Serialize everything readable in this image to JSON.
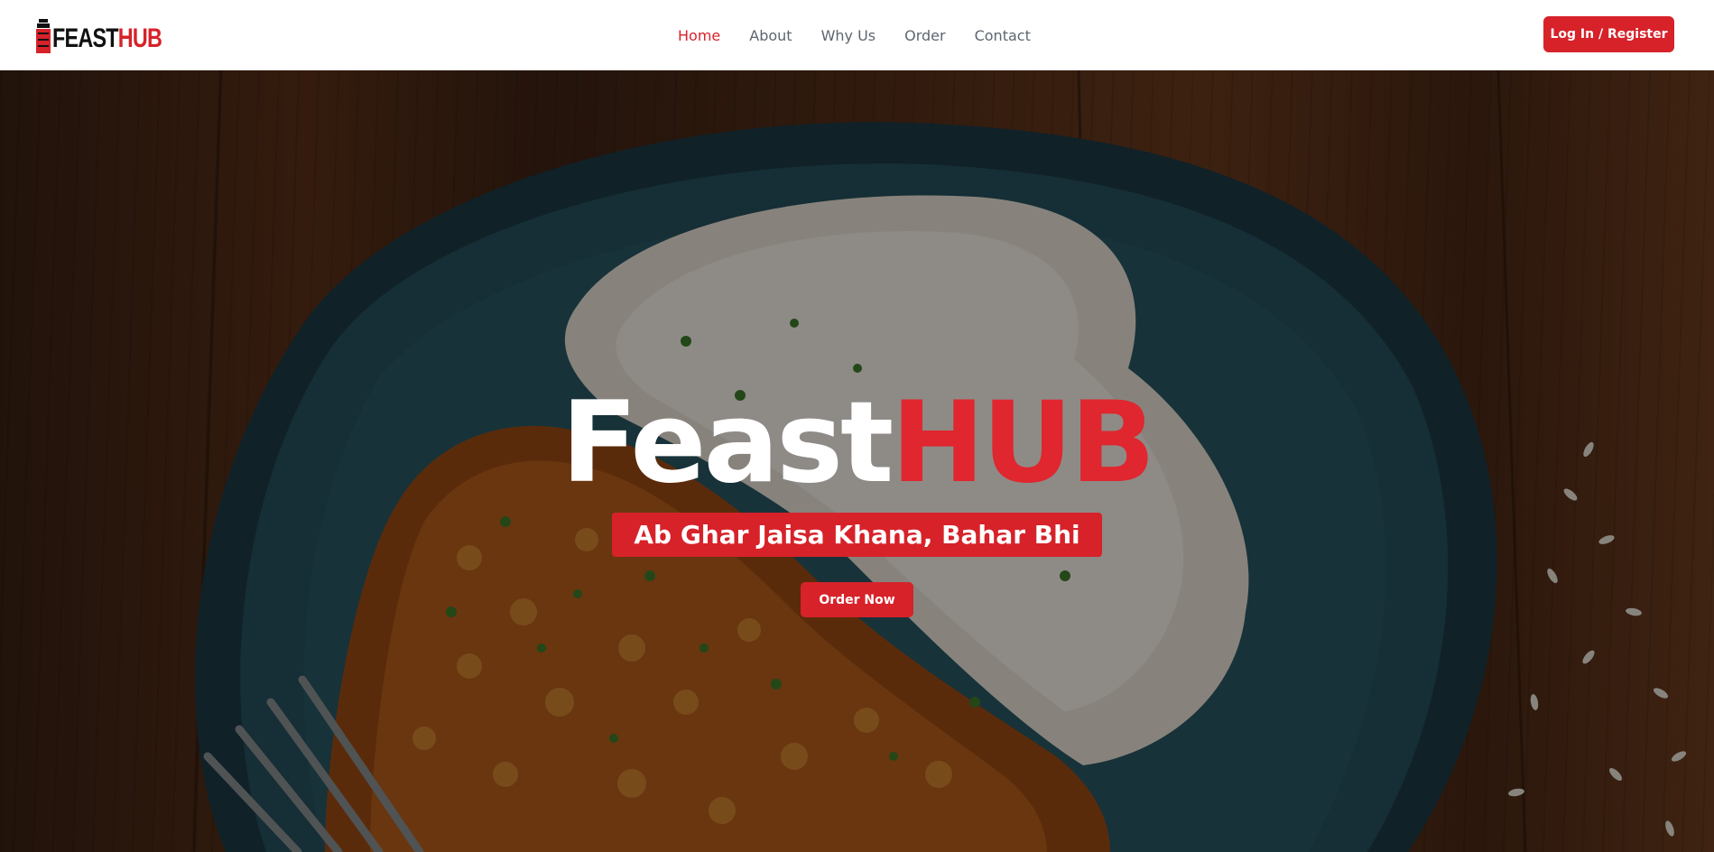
{
  "brand": {
    "logo_part1": "FEAST",
    "logo_part2": "HUB",
    "accent_color": "#d7222a"
  },
  "nav": {
    "links": [
      {
        "label": "Home",
        "active": true
      },
      {
        "label": "About",
        "active": false
      },
      {
        "label": "Why Us",
        "active": false
      },
      {
        "label": "Order",
        "active": false
      },
      {
        "label": "Contact",
        "active": false
      }
    ],
    "login_label": "Log In / Register"
  },
  "hero": {
    "title_part1": "Feast",
    "title_part2": "HUB",
    "tagline": "Ab Ghar Jaisa Khana, Bahar Bhi",
    "cta_label": "Order Now",
    "background": "photo of chickpea curry with white rice on a dark blue speckled plate on a wooden table, with a fork"
  }
}
